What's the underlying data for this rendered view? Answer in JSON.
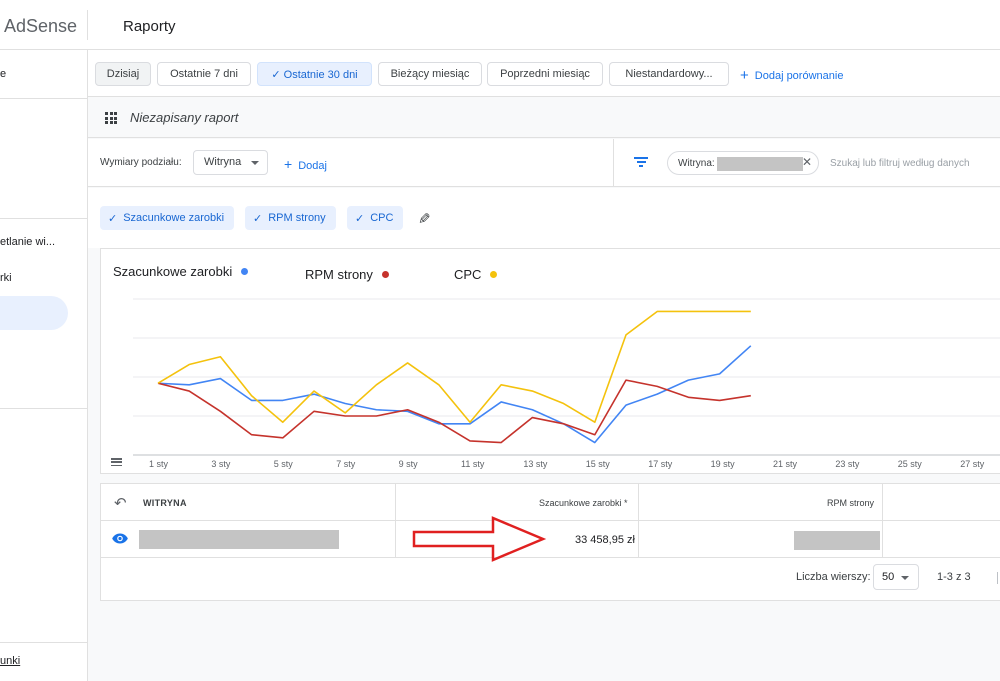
{
  "brand": "AdSense",
  "page_title": "Raporty",
  "sidebar": {
    "items": [
      {
        "label": "e"
      },
      {
        "label": "etlanie wi..."
      },
      {
        "label": "rki"
      }
    ],
    "bottom_link": "unki"
  },
  "date_filters": [
    {
      "label": "Dzisiaj",
      "selected": false
    },
    {
      "label": "Ostatnie 7 dni",
      "selected": false
    },
    {
      "label": "✓  Ostatnie 30 dni",
      "selected": true
    },
    {
      "label": "Bieżący miesiąc",
      "selected": false
    },
    {
      "label": "Poprzedni miesiąc",
      "selected": false
    },
    {
      "label": "Niestandardowy...",
      "selected": false
    }
  ],
  "add_comparison": "Dodaj porównanie",
  "report_name": "Niezapisany raport",
  "dimensions": {
    "label": "Wymiary podziału:",
    "selected": "Witryna",
    "add_label": "Dodaj"
  },
  "filter": {
    "chip_label": "Witryna:",
    "search_placeholder": "Szukaj lub filtruj według danych"
  },
  "metrics": [
    {
      "label": "Szacunkowe zarobki",
      "check": "✓"
    },
    {
      "label": "RPM strony",
      "check": "✓"
    },
    {
      "label": "CPC",
      "check": "✓"
    }
  ],
  "colors": {
    "blue": "#4285f4",
    "red": "#c5332c",
    "yellow": "#f4c20d",
    "accent": "#1a73e8",
    "arrow": "#e02020"
  },
  "chart_data": {
    "type": "line",
    "x": [
      "1 sty",
      "2 sty",
      "3 sty",
      "4 sty",
      "5 sty",
      "6 sty",
      "7 sty",
      "8 sty",
      "9 sty",
      "10 sty",
      "11 sty",
      "12 sty",
      "13 sty",
      "14 sty",
      "15 sty",
      "16 sty",
      "17 sty",
      "18 sty",
      "19 sty",
      "20 sty",
      "21 sty",
      "22 sty",
      "23 sty",
      "24 sty",
      "25 sty",
      "26 sty",
      "27 sty",
      "28 sty"
    ],
    "tick_labels": [
      "1 sty",
      "3 sty",
      "5 sty",
      "7 sty",
      "9 sty",
      "11 sty",
      "13 sty",
      "15 sty",
      "17 sty",
      "19 sty",
      "21 sty",
      "23 sty",
      "25 sty",
      "27 sty"
    ],
    "series": [
      {
        "name": "Szacunkowe zarobki",
        "color": "#4285f4",
        "values": [
          54,
          55,
          51,
          65,
          65,
          61,
          67,
          71,
          72,
          80,
          80,
          66,
          71,
          80,
          92,
          68,
          61,
          52,
          48,
          30
        ]
      },
      {
        "name": "RPM strony",
        "color": "#c5332c",
        "values": [
          54,
          59,
          72,
          87,
          89,
          72,
          75,
          75,
          71,
          79,
          91,
          92,
          76,
          80,
          87,
          52,
          56,
          63,
          65,
          62
        ]
      },
      {
        "name": "CPC",
        "color": "#f4c20d",
        "values": [
          54,
          42,
          37,
          62,
          79,
          59,
          73,
          55,
          41,
          55,
          79,
          55,
          59,
          67,
          79,
          23,
          8,
          8,
          8,
          8
        ]
      }
    ],
    "grid": true,
    "legend_position": "top",
    "xlabel": "",
    "ylabel": ""
  },
  "table": {
    "columns": [
      "WITRYNA",
      "Szacunkowe zarobki *",
      "RPM strony"
    ],
    "rows": [
      {
        "earnings": "33 458,95 zł"
      }
    ],
    "rows_per_page_label": "Liczba wierszy:",
    "rows_per_page_value": "50",
    "range": "1-3 z 3"
  }
}
